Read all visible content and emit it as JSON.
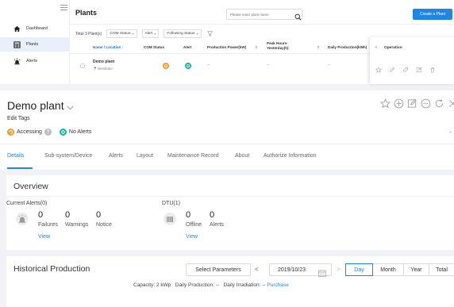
{
  "sidebar": {
    "items": [
      {
        "label": "Dashboard",
        "icon": "home-icon"
      },
      {
        "label": "Plants",
        "icon": "plants-icon"
      },
      {
        "label": "Alerts",
        "icon": "alert-siren-icon"
      }
    ]
  },
  "plant_list": {
    "title": "Plants",
    "search_placeholder": "Please enter plant name",
    "create_button": "Create a Plant",
    "total": "Total 3 Plant(s)",
    "filters": [
      "COM Status",
      "Alert",
      "Following Status"
    ],
    "columns": {
      "name": "Name / Location",
      "name_sort": "↑",
      "com": "COM Status",
      "alert": "Alert",
      "production": "Production Power(kW)",
      "sort1": "⇕",
      "peak": "Peak Hours-Yesterday(h)",
      "sort2": "⇕",
      "daily": "Daily Production(kWh)"
    },
    "operation_label": "Operation",
    "operation_chevron": "»",
    "row": {
      "name": "Demo plant",
      "location": "Westlake",
      "production": "--",
      "peak": "--",
      "daily": "--"
    }
  },
  "detail": {
    "plant_name": "Demo plant",
    "edit_tags": "Edit Tags",
    "status_accessing": "Accessing",
    "help_mark": "?",
    "status_alerts": "No Alerts",
    "right_dash": "-",
    "tabs": [
      "Details",
      "Sub-system/Device",
      "Alerts",
      "Layout",
      "Maintenance Record",
      "About",
      "Authorize Information"
    ],
    "overview": {
      "title": "Overview",
      "current_alerts_label": "Current Alerts(0)",
      "failures": {
        "value": "0",
        "label": "Failures"
      },
      "warnings": {
        "value": "0",
        "label": "Warnings"
      },
      "notice": {
        "value": "0",
        "label": "Notice"
      },
      "alerts_view": "View",
      "dtu_label": "DTU(1)",
      "offline": {
        "value": "0",
        "label": "Offline"
      },
      "dtu_alerts": {
        "value": "0",
        "label": "Alerts"
      },
      "dtu_view": "View"
    },
    "history": {
      "title": "Historical Production",
      "select_params": "Select Parameters",
      "prev": "<",
      "next": ">",
      "date": "2019/10/23",
      "ranges": [
        "Day",
        "Month",
        "Year",
        "Total"
      ],
      "active_range": "Day",
      "capacity": "Capacity: 2 kWp",
      "daily_production": "Daily Production: --",
      "daily_irradiation": "Daily Irradiation: --",
      "purchase": "Purchase"
    }
  },
  "colors": {
    "accent": "#1d86e6",
    "accessing": "#f39c2c",
    "no_alerts": "#1bb5a6",
    "background": "#f0f2f5"
  }
}
